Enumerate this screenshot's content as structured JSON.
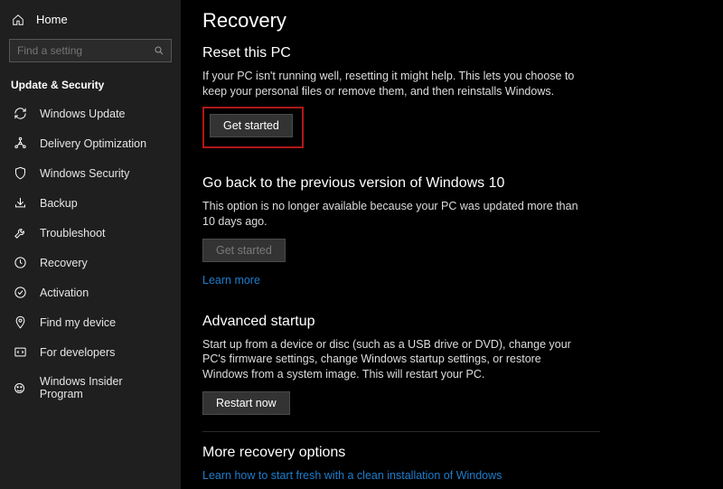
{
  "sidebar": {
    "home_label": "Home",
    "search_placeholder": "Find a setting",
    "category_label": "Update & Security",
    "items": [
      {
        "label": "Windows Update",
        "icon": "refresh-icon"
      },
      {
        "label": "Delivery Optimization",
        "icon": "delivery-icon"
      },
      {
        "label": "Windows Security",
        "icon": "shield-icon"
      },
      {
        "label": "Backup",
        "icon": "backup-icon"
      },
      {
        "label": "Troubleshoot",
        "icon": "wrench-icon"
      },
      {
        "label": "Recovery",
        "icon": "recovery-icon"
      },
      {
        "label": "Activation",
        "icon": "activation-icon"
      },
      {
        "label": "Find my device",
        "icon": "location-icon"
      },
      {
        "label": "For developers",
        "icon": "developers-icon"
      },
      {
        "label": "Windows Insider Program",
        "icon": "insider-icon"
      }
    ]
  },
  "page": {
    "title": "Recovery",
    "reset": {
      "title": "Reset this PC",
      "text": "If your PC isn't running well, resetting it might help. This lets you choose to keep your personal files or remove them, and then reinstalls Windows.",
      "button": "Get started"
    },
    "goback": {
      "title": "Go back to the previous version of Windows 10",
      "text": "This option is no longer available because your PC was updated more than 10 days ago.",
      "button": "Get started",
      "link": "Learn more"
    },
    "advanced": {
      "title": "Advanced startup",
      "text": "Start up from a device or disc (such as a USB drive or DVD), change your PC's firmware settings, change Windows startup settings, or restore Windows from a system image. This will restart your PC.",
      "button": "Restart now"
    },
    "more": {
      "title": "More recovery options",
      "link": "Learn how to start fresh with a clean installation of Windows"
    }
  }
}
